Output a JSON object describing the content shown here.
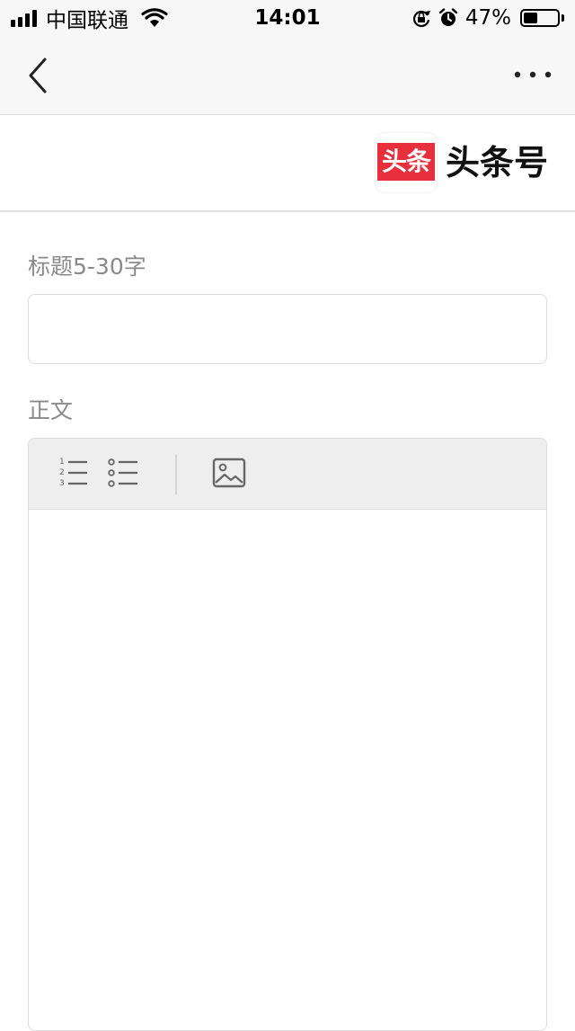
{
  "status_bar": {
    "carrier": "中国联通",
    "time": "14:01",
    "battery": "47%",
    "battery_level": 0.47
  },
  "nav": {
    "back_icon": "chevron-left-icon",
    "more_icon": "more-dots-icon"
  },
  "brand": {
    "logo_text": "头条",
    "name": "头条号",
    "logo_color": "#e7303c"
  },
  "form": {
    "title_label": "标题5-30字",
    "title_value": "",
    "body_label": "正文",
    "toolbar": [
      "ordered-list-icon",
      "bullet-list-icon",
      "image-icon"
    ]
  }
}
